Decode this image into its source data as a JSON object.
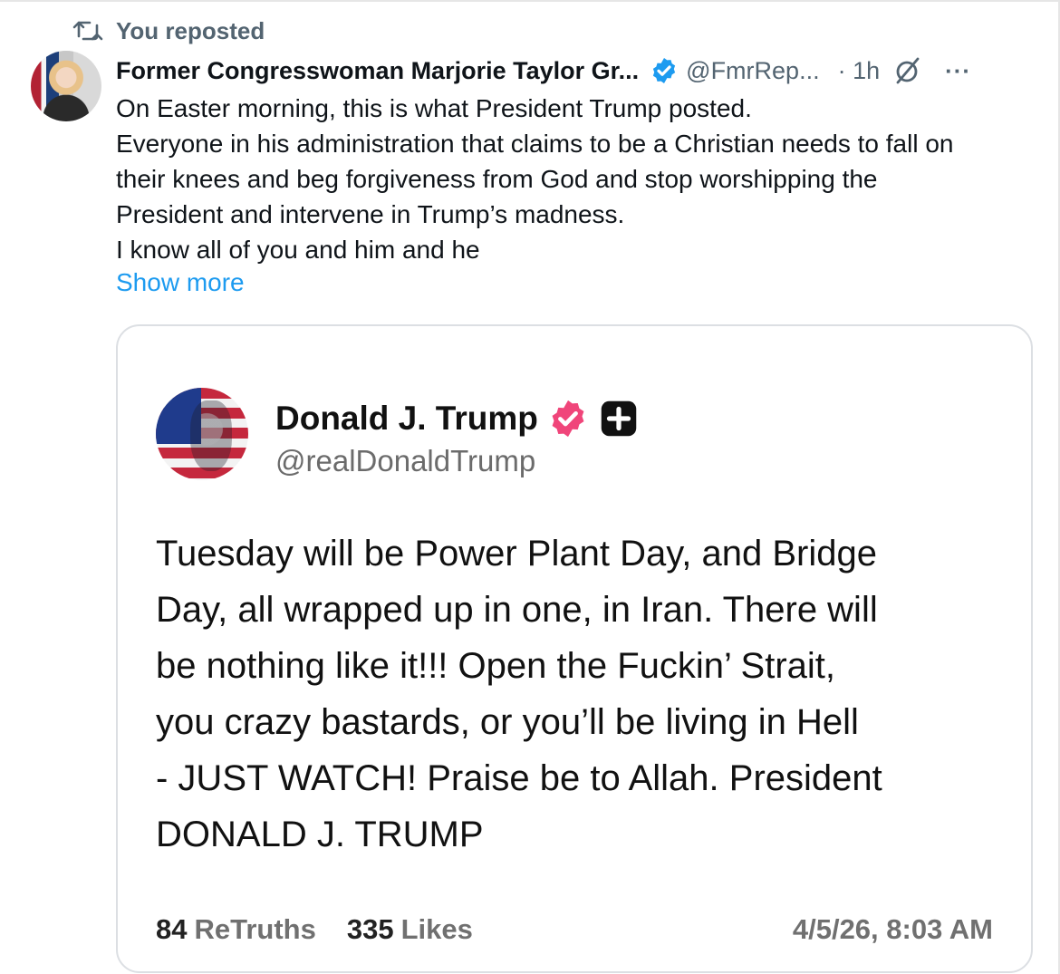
{
  "repost": {
    "label": "You reposted",
    "icon": "repost-icon"
  },
  "tweet": {
    "author_name": "Former Congresswoman Marjorie Taylor Gr...",
    "handle": "@FmrRep...",
    "time": "· 1h",
    "verified_icon": "verified-badge-icon",
    "more_label": "···",
    "body_lines": [
      "On Easter morning, this is what President Trump posted.",
      "Everyone in his administration that claims to be a Christian needs to fall on",
      "their knees and beg forgiveness from God and stop worshipping the",
      "President and intervene in Trump’s madness.",
      "I know all of you and him and he"
    ],
    "show_more": "Show more",
    "accent_color": "#1d9bf0"
  },
  "quote": {
    "author_name": "Donald J. Trump",
    "handle": "@realDonaldTrump",
    "badge_color": "#f0457a",
    "body_lines": [
      "Tuesday will be Power Plant Day, and Bridge",
      "Day, all wrapped up in one, in Iran. There will",
      "be nothing like it!!! Open the Fuckin’ Strait,",
      "you crazy bastards, or you’ll be living in Hell",
      "- JUST WATCH! Praise be to Allah. President",
      "DONALD J. TRUMP"
    ],
    "retruths_count": "84",
    "retruths_label": "ReTruths",
    "likes_count": "335",
    "likes_label": "Likes",
    "timestamp": "4/5/26, 8:03 AM"
  }
}
